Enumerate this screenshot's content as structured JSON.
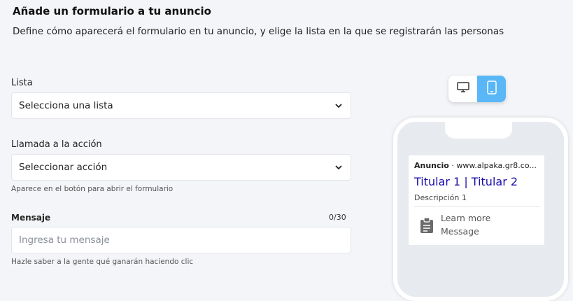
{
  "header": {
    "title": "Añade un formulario a tu anuncio",
    "subtitle": "Define cómo aparecerá el formulario en tu anuncio, y elige la lista en la que se registrarán las personas"
  },
  "form": {
    "list": {
      "label": "Lista",
      "value": "Selecciona una lista"
    },
    "cta": {
      "label": "Llamada a la acción",
      "value": "Seleccionar acción",
      "help": "Aparece en el botón para abrir el formulario"
    },
    "message": {
      "label": "Mensaje",
      "counter": "0/30",
      "placeholder": "Ingresa tu mensaje",
      "help": "Hazle saber a la gente qué ganarán haciendo clic"
    }
  },
  "preview": {
    "active_device": "mobile",
    "ad_label": "Anuncio",
    "ad_separator": "·",
    "ad_url": "www.alpaka.gr8.co...",
    "ad_title": "Titular 1 | Titular 2",
    "ad_description": "Descripción 1",
    "learn_more": "Learn more",
    "message": "Message"
  },
  "colors": {
    "accent": "#5ab7f7",
    "ad_title": "#1a0dab",
    "background": "#f4f5f8"
  },
  "icons": [
    "chevron-down-icon",
    "desktop-icon",
    "mobile-icon",
    "clipboard-icon"
  ]
}
